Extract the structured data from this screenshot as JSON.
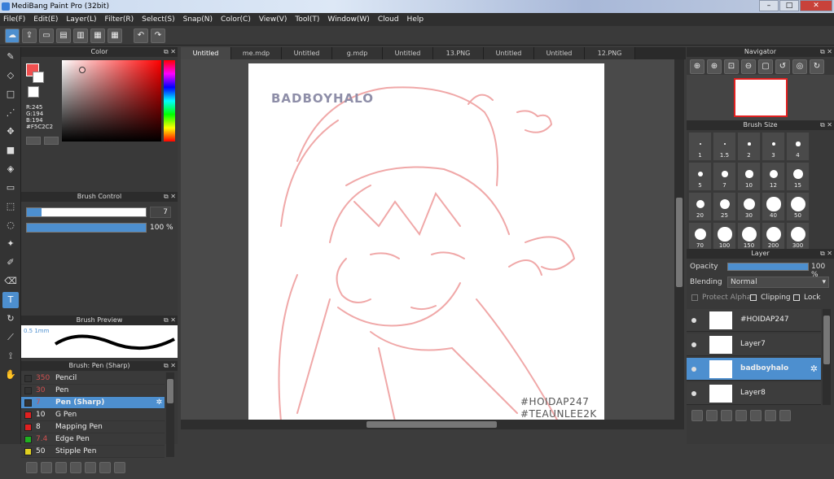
{
  "window": {
    "title": "MediBang Paint Pro (32bit)",
    "controls": [
      "–",
      "□",
      "✕"
    ]
  },
  "menu": [
    "File(F)",
    "Edit(E)",
    "Layer(L)",
    "Filter(R)",
    "Select(S)",
    "Snap(N)",
    "Color(C)",
    "View(V)",
    "Tool(T)",
    "Window(W)",
    "Cloud",
    "Help"
  ],
  "panels": {
    "color": "Color",
    "brush_control": "Brush Control",
    "brush_preview": "Brush Preview",
    "brush_list": "Brush: Pen (Sharp)",
    "navigator": "Navigator",
    "brush_size": "Brush Size",
    "layer": "Layer"
  },
  "color": {
    "r": "R:245",
    "g": "G:194",
    "b": "B:194",
    "hex": "#F5C2C2",
    "fg": "#f05050"
  },
  "brush_control": {
    "size": "7",
    "opacity": "100 %"
  },
  "brush_preview": {
    "size_label": "0.5 1mm"
  },
  "tabs": [
    "Untitled",
    "me.mdp",
    "Untitled",
    "g.mdp",
    "Untitled",
    "13.PNG",
    "Untitled",
    "Untitled",
    "12.PNG"
  ],
  "canvas": {
    "watermark": "BADBOYHALO",
    "tag1": "#HOIDAP247",
    "tag2": "#TEAUNLEE2K"
  },
  "brushes": [
    {
      "num": "350",
      "name": "Pencil",
      "color": "#333333"
    },
    {
      "num": "30",
      "name": "Pen",
      "color": "#333333"
    },
    {
      "num": "7",
      "name": "Pen (Sharp)",
      "color": "#333333"
    },
    {
      "num": "10",
      "name": "G Pen",
      "color": "#e02020"
    },
    {
      "num": "8",
      "name": "Mapping Pen",
      "color": "#e02020"
    },
    {
      "num": "7.4",
      "name": "Edge Pen",
      "color": "#20b020"
    },
    {
      "num": "50",
      "name": "Stipple Pen",
      "color": "#e0d020"
    }
  ],
  "brush_sizes": [
    "1",
    "1.5",
    "2",
    "3",
    "4",
    "5",
    "7",
    "10",
    "12",
    "15",
    "20",
    "25",
    "30",
    "40",
    "50",
    "70",
    "100",
    "150",
    "200",
    "300"
  ],
  "layer_panel": {
    "opacity_label": "Opacity",
    "opacity_value": "100 %",
    "blending_label": "Blending",
    "blending_value": "Normal",
    "protect_alpha": "Protect Alpha",
    "clipping": "Clipping",
    "lock": "Lock"
  },
  "layers": [
    "#HOIDAP247",
    "Layer7",
    "badboyhalo",
    "Layer8"
  ]
}
